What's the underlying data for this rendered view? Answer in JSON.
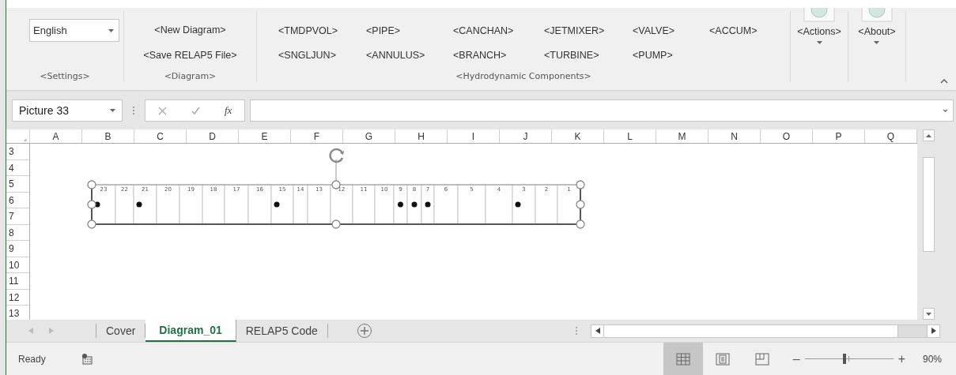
{
  "ribbon": {
    "groups": [
      {
        "kind": "settings",
        "label": "<Settings>",
        "dropdown": {
          "value": "English"
        }
      },
      {
        "kind": "stack",
        "label": "<Diagram>",
        "buttons": [
          "<New Diagram>",
          "<Save RELAP5 File>"
        ]
      },
      {
        "kind": "grid",
        "label": "<Hydrodynamic Components>",
        "buttons": [
          "<TMDPVOL>",
          "<PIPE>",
          "<CANCHAN>",
          "<JETMIXER>",
          "<VALVE>",
          "<ACCUM>",
          "<SNGLJUN>",
          "<ANNULUS>",
          "<BRANCH>",
          "<TURBINE>",
          "<PUMP>"
        ]
      },
      {
        "kind": "menu",
        "button": "<Actions>"
      },
      {
        "kind": "menu",
        "button": "<About>"
      }
    ]
  },
  "formula_bar": {
    "name_box": "Picture 33",
    "function_label": "fx"
  },
  "sheet": {
    "columns": [
      "A",
      "B",
      "C",
      "D",
      "E",
      "F",
      "G",
      "H",
      "I",
      "J",
      "K",
      "L",
      "M",
      "N",
      "O",
      "P",
      "Q"
    ],
    "rows": [
      "3",
      "4",
      "5",
      "6",
      "7",
      "8",
      "9",
      "10",
      "11",
      "12",
      "13"
    ]
  },
  "diagram": {
    "selected": true,
    "cells": [
      {
        "label": "23",
        "marker": true
      },
      {
        "label": "22",
        "marker": false
      },
      {
        "label": "21",
        "marker": true
      },
      {
        "label": "20",
        "marker": false
      },
      {
        "label": "19",
        "marker": false
      },
      {
        "label": "18",
        "marker": false
      },
      {
        "label": "17",
        "marker": false
      },
      {
        "label": "16",
        "marker": false
      },
      {
        "label": "15",
        "marker": true
      },
      {
        "label": "14",
        "marker": false
      },
      {
        "label": "13",
        "marker": false
      },
      {
        "label": "12",
        "marker": false
      },
      {
        "label": "11",
        "marker": false
      },
      {
        "label": "10",
        "marker": false
      },
      {
        "label": "9",
        "marker": true
      },
      {
        "label": "8",
        "marker": true
      },
      {
        "label": "7",
        "marker": true
      },
      {
        "label": "6",
        "marker": false
      },
      {
        "label": "5",
        "marker": false
      },
      {
        "label": "4",
        "marker": false
      },
      {
        "label": "3",
        "marker": true
      },
      {
        "label": "2",
        "marker": false
      },
      {
        "label": "1",
        "marker": false
      }
    ]
  },
  "sheet_tabs": [
    {
      "label": "Cover",
      "selected": false
    },
    {
      "label": "Diagram_01",
      "selected": true
    },
    {
      "label": "RELAP5 Code",
      "selected": false
    }
  ],
  "status_bar": {
    "text": "Ready",
    "views": [
      {
        "kind": "normal",
        "selected": true
      },
      {
        "kind": "page_layout",
        "selected": false
      },
      {
        "kind": "page_break",
        "selected": false
      }
    ],
    "zoom": {
      "out_label": "–",
      "in_label": "+",
      "level": 0.45,
      "reading": "90%"
    }
  }
}
